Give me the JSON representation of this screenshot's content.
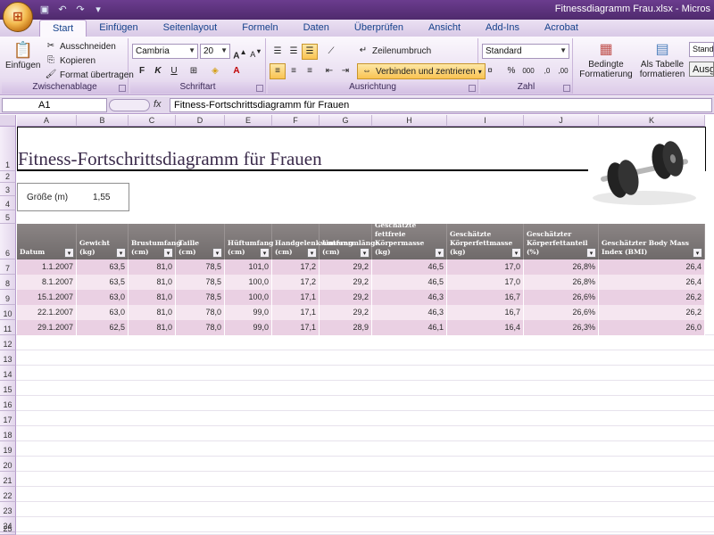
{
  "window": {
    "title": "Fitnessdiagramm Frau.xlsx - Micros"
  },
  "tabs": [
    "Start",
    "Einfügen",
    "Seitenlayout",
    "Formeln",
    "Daten",
    "Überprüfen",
    "Ansicht",
    "Add-Ins",
    "Acrobat"
  ],
  "ribbon": {
    "clipboard": {
      "label": "Zwischenablage",
      "paste": "Einfügen",
      "cut": "Ausschneiden",
      "copy": "Kopieren",
      "format_painter": "Format übertragen"
    },
    "font": {
      "label": "Schriftart",
      "font_name": "Cambria",
      "font_size": "20",
      "bold": "F",
      "italic": "K",
      "underline": "U"
    },
    "alignment": {
      "label": "Ausrichtung",
      "wrap": "Zeilenumbruch",
      "merge": "Verbinden und zentrieren"
    },
    "number": {
      "label": "Zahl",
      "format": "Standard",
      "percent": "%",
      "thousands": "000"
    },
    "styles": {
      "conditional": "Bedingte Formatierung",
      "as_table": "Als Tabelle formatieren",
      "standard": "Standa",
      "output": "Ausg"
    }
  },
  "formula_bar": {
    "name_box": "A1",
    "fx": "fx",
    "formula": "Fitness-Fortschrittsdiagramm für Frauen"
  },
  "columns": [
    "A",
    "B",
    "C",
    "D",
    "E",
    "F",
    "G",
    "H",
    "I",
    "J",
    "K"
  ],
  "rows": [
    "1",
    "2",
    "3",
    "4",
    "5",
    "6",
    "7",
    "8",
    "9",
    "10",
    "11",
    "12",
    "13",
    "14",
    "15",
    "16",
    "17",
    "18",
    "19",
    "20",
    "21",
    "22",
    "23",
    "24",
    "25"
  ],
  "sheet": {
    "title": "Fitness-Fortschrittsdiagramm für Frauen",
    "size_label": "Größe (m)",
    "size_value": "1,55",
    "headers": [
      "Datum",
      "Gewicht (kg)",
      "Brustumfang (cm)",
      "Taille (cm)",
      "Hüftumfang (cm)",
      "Handgelenksumfang (cm)",
      "Unterarmlänge (cm)",
      "Geschätzte fettfreie Körpermasse (kg)",
      "Geschätzte Körperfettmasse (kg)",
      "Geschätzter Körperfettanteil (%)",
      "Geschätzter Body Mass Index (BMI)"
    ],
    "data": [
      [
        "1.1.2007",
        "63,5",
        "81,0",
        "78,5",
        "101,0",
        "17,2",
        "29,2",
        "46,5",
        "17,0",
        "26,8%",
        "26,4"
      ],
      [
        "8.1.2007",
        "63,5",
        "81,0",
        "78,5",
        "100,0",
        "17,2",
        "29,2",
        "46,5",
        "17,0",
        "26,8%",
        "26,4"
      ],
      [
        "15.1.2007",
        "63,0",
        "81,0",
        "78,5",
        "100,0",
        "17,1",
        "29,2",
        "46,3",
        "16,7",
        "26,6%",
        "26,2"
      ],
      [
        "22.1.2007",
        "63,0",
        "81,0",
        "78,0",
        "99,0",
        "17,1",
        "29,2",
        "46,3",
        "16,7",
        "26,6%",
        "26,2"
      ],
      [
        "29.1.2007",
        "62,5",
        "81,0",
        "78,0",
        "99,0",
        "17,1",
        "28,9",
        "46,1",
        "16,4",
        "26,3%",
        "26,0"
      ]
    ]
  }
}
